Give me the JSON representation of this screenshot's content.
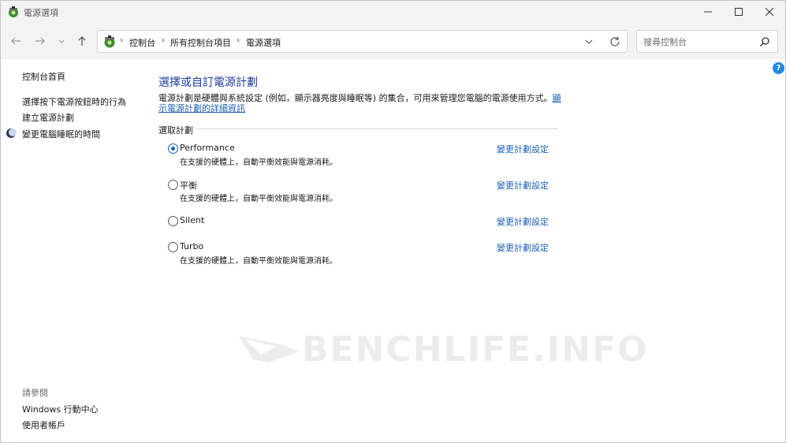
{
  "window": {
    "title": "電源選項"
  },
  "address": {
    "crumbs": [
      "控制台",
      "所有控制台項目",
      "電源選項"
    ]
  },
  "search": {
    "placeholder": "搜尋控制台"
  },
  "help": {
    "label": "?"
  },
  "sidebar": {
    "home": "控制台首頁",
    "links": [
      "選擇按下電源按鈕時的行為",
      "建立電源計劃",
      "變更電腦睡眠的時間"
    ],
    "see_also": "請參閱",
    "see_also_links": [
      "Windows 行動中心",
      "使用者帳戶"
    ]
  },
  "main": {
    "title": "選擇或自訂電源計劃",
    "description": "電源計劃是硬體與系統設定 (例如，顯示器亮度與睡眠等) 的集合，可用來管理您電腦的電源使用方式。",
    "description_link": "顯示電源計劃的詳細資訊",
    "section_label": "選取計劃",
    "plans": [
      {
        "name": "Performance",
        "description": "在支援的硬體上，自動平衡效能與電源消耗。",
        "selected": true,
        "change_label": "變更計劃設定"
      },
      {
        "name": "平衡",
        "description": "在支援的硬體上，自動平衡效能與電源消耗。",
        "selected": false,
        "change_label": "變更計劃設定"
      },
      {
        "name": "Silent",
        "description": "",
        "selected": false,
        "change_label": "變更計劃設定"
      },
      {
        "name": "Turbo",
        "description": "在支援的硬體上，自動平衡效能與電源消耗。",
        "selected": false,
        "change_label": "變更計劃設定"
      }
    ]
  },
  "watermark": {
    "text": "BENCHLIFE.INFO"
  },
  "colors": {
    "link": "#1a5fb4",
    "title": "#1e3f9e",
    "help": "#1e88e5"
  }
}
